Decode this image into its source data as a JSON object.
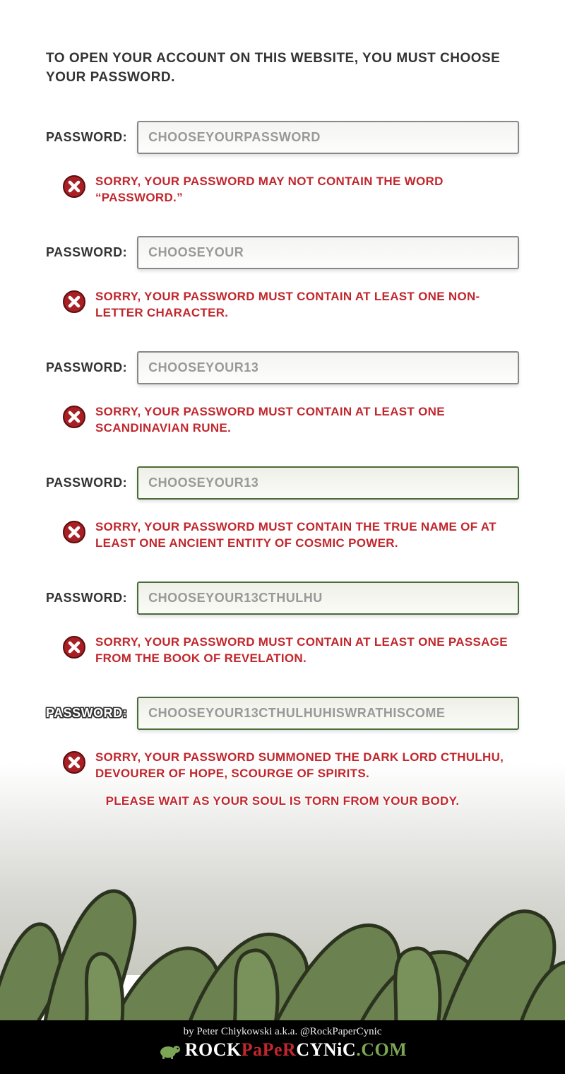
{
  "intro": "TO OPEN YOUR ACCOUNT ON THIS WEBSITE, YOU MUST CHOOSE YOUR PASSWORD.",
  "label": "PASSWORD:",
  "attempts": [
    {
      "value": "CHOOSEYOURPASSWORD",
      "green": false,
      "error": "SORRY, YOUR PASSWORD MAY NOT CONTAIN THE WORD “PASSWORD.”"
    },
    {
      "value": "CHOOSEYOUR",
      "green": false,
      "error": "SORRY, YOUR PASSWORD MUST CONTAIN AT LEAST ONE NON-LETTER CHARACTER."
    },
    {
      "value": "CHOOSEYOUR13",
      "green": false,
      "error": "SORRY, YOUR PASSWORD MUST CONTAIN AT LEAST ONE SCANDINAVIAN RUNE."
    },
    {
      "value": "CHOOSEYOUR13",
      "green": true,
      "error": "SORRY, YOUR PASSWORD MUST CONTAIN THE TRUE NAME OF AT LEAST ONE ANCIENT ENTITY OF COSMIC POWER."
    },
    {
      "value": "CHOOSEYOUR13CTHULHU",
      "green": true,
      "error": "SORRY, YOUR PASSWORD MUST CONTAIN AT LEAST ONE PASSAGE FROM THE BOOK OF REVELATION."
    },
    {
      "value": "CHOOSEYOUR13CTHULHUHISWRATHISCOME",
      "green": true,
      "error": "SORRY, YOUR PASSWORD SUMMONED THE DARK LORD CTHULHU, DEVOURER OF HOPE, SCOURGE OF SPIRITS."
    }
  ],
  "final": "PLEASE WAIT AS YOUR SOUL IS TORN FROM YOUR BODY.",
  "footer": {
    "byline": "by Peter Chiykowski a.k.a. @RockPaperCynic",
    "logo_rock": "ROCK",
    "logo_paper": "PaPeR",
    "logo_cynic": "CYNiC",
    "logo_com": ".COM"
  }
}
